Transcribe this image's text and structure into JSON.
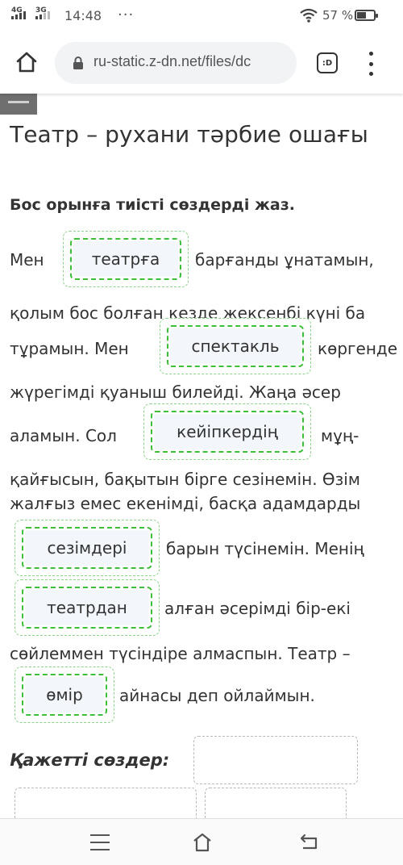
{
  "status_bar": {
    "network1": "4G",
    "network2": "3G",
    "time": "14:48",
    "more": "···",
    "battery_text": "57 %",
    "battery_level": 0.57
  },
  "browser": {
    "url": "ru-static.z-dn.net/files/dc",
    "tabs_label": ":D"
  },
  "page": {
    "title": "Театр – рухани тәрбие ошағы",
    "instruction": "Бос орынға тиісті сөздерді жаз."
  },
  "passage": {
    "line1_a": "Мен",
    "line1_b": "барғанды ұнатамын,",
    "line2": "қолым бос болған кезде жексенбі күні ба",
    "line3_a": "тұрамын. Мен",
    "line3_b": "көргенде",
    "line4": "жүрегімді қуаныш билейді. Жаңа әсер",
    "line5_a": "аламын. Сол",
    "line5_b": "мұң-",
    "line6": "қайғысын, бақытын бірге сезінемін. Өзім",
    "line7": "жалғыз емес екенімді, басқа адамдарды",
    "line8_b": "барын түсінемін. Менің",
    "line9_b": "алған әсерімді бір-екі",
    "line10": "сөйлеммен түсіндіре алмаспын. Театр –",
    "line11_b": "айнасы деп ойлаймын."
  },
  "answers": {
    "a1": "театрға",
    "a2": "спектакль",
    "a3": "кейіпкердің",
    "a4": "сезімдері",
    "a5": "театрдан",
    "a6": "өмір"
  },
  "words_section": {
    "label": "Қажетті сөздер:"
  },
  "colors": {
    "accent_green": "#3dbf3a",
    "word_bg": "#f3f6fa"
  }
}
